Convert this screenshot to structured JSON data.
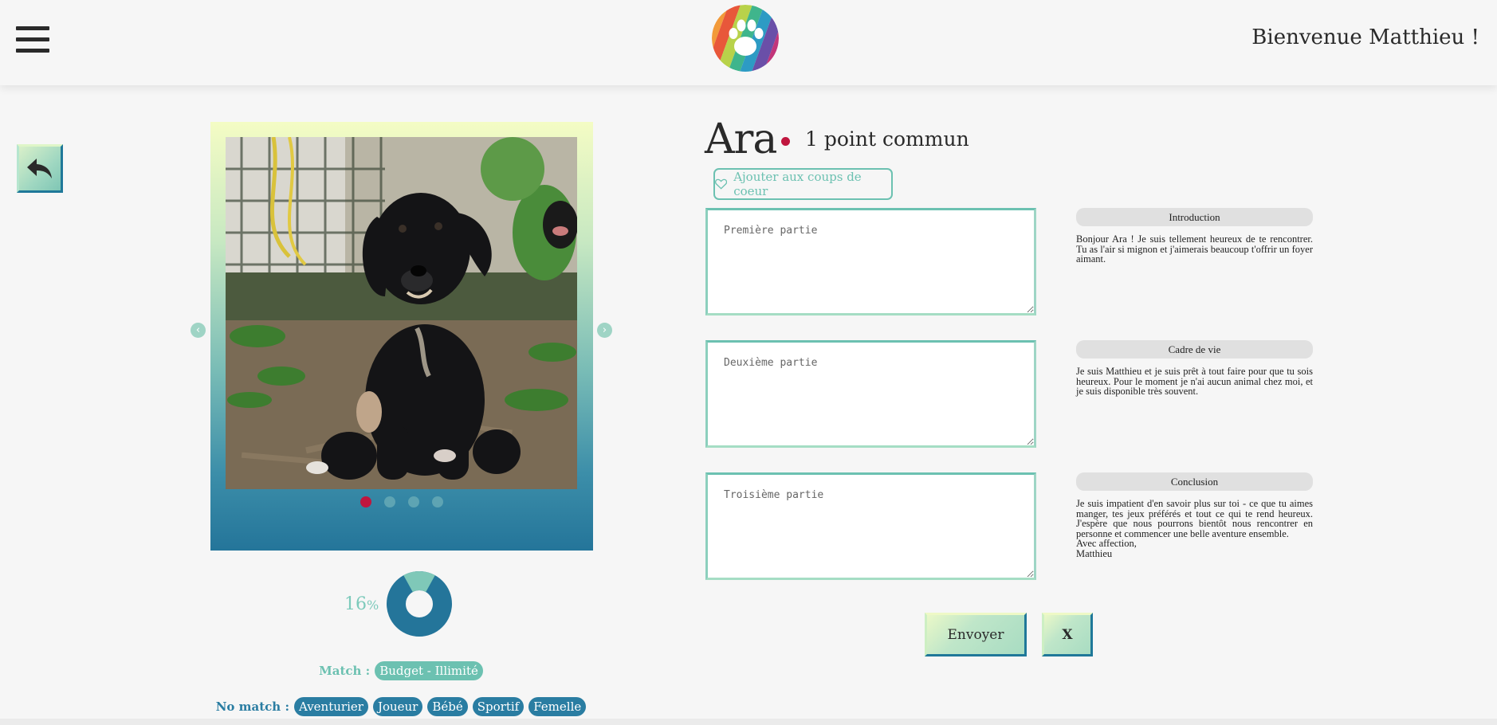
{
  "header": {
    "welcome": "Bienvenue Matthieu !",
    "menu_icon": "hamburger-menu-icon",
    "logo_icon": "rainbow-paw-logo"
  },
  "navigation": {
    "back_icon": "reply-arrow-icon"
  },
  "carousel": {
    "photo": "black-puppy-photo",
    "slide_count": 4,
    "active_slide": 1,
    "prev_icon": "chevron-left-icon",
    "next_icon": "chevron-right-icon"
  },
  "compatibility": {
    "percent": 16,
    "percent_number": "16",
    "percent_unit": "%"
  },
  "match": {
    "label": "Match :",
    "tags": [
      "Budget - Illimité"
    ]
  },
  "no_match": {
    "label": "No match :",
    "tags": [
      "Aventurier",
      "Joueur",
      "Bébé",
      "Sportif",
      "Femelle"
    ]
  },
  "pet": {
    "name": "Ara",
    "common": "1 point commun"
  },
  "favorite_button": {
    "label": "Ajouter aux coups de coeur",
    "icon": "heart-outline-icon"
  },
  "parts": [
    {
      "placeholder": "Première partie",
      "value": "",
      "title": "Introduction",
      "text": "Bonjour Ara ! Je suis tellement heureux de te rencontrer. Tu as l'air si mignon et j'aimerais beaucoup t'offrir un foyer aimant."
    },
    {
      "placeholder": "Deuxième partie",
      "value": "",
      "title": "Cadre de vie",
      "text": "Je suis Matthieu et je suis prêt à tout faire pour que tu sois heureux. Pour le moment je n'ai aucun animal chez moi, et je suis disponible très souvent."
    },
    {
      "placeholder": "Troisième partie",
      "value": "",
      "title": "Conclusion",
      "text_lines": [
        "Je suis impatient d'en savoir plus sur toi - ce que tu aimes manger, tes jeux préférés et tout ce qui te rend heureux. J'espère que nous pourrons bientôt nous rencontrer en personne et commencer une belle aventure ensemble.",
        "Avec affection,",
        "Matthieu"
      ]
    }
  ],
  "actions": {
    "send_label": "Envoyer",
    "close_label": "X"
  },
  "colors": {
    "accent_teal": "#6cc1b1",
    "accent_blue": "#2a7da2",
    "active_red": "#c0163e",
    "background": "#f6f6f6"
  }
}
